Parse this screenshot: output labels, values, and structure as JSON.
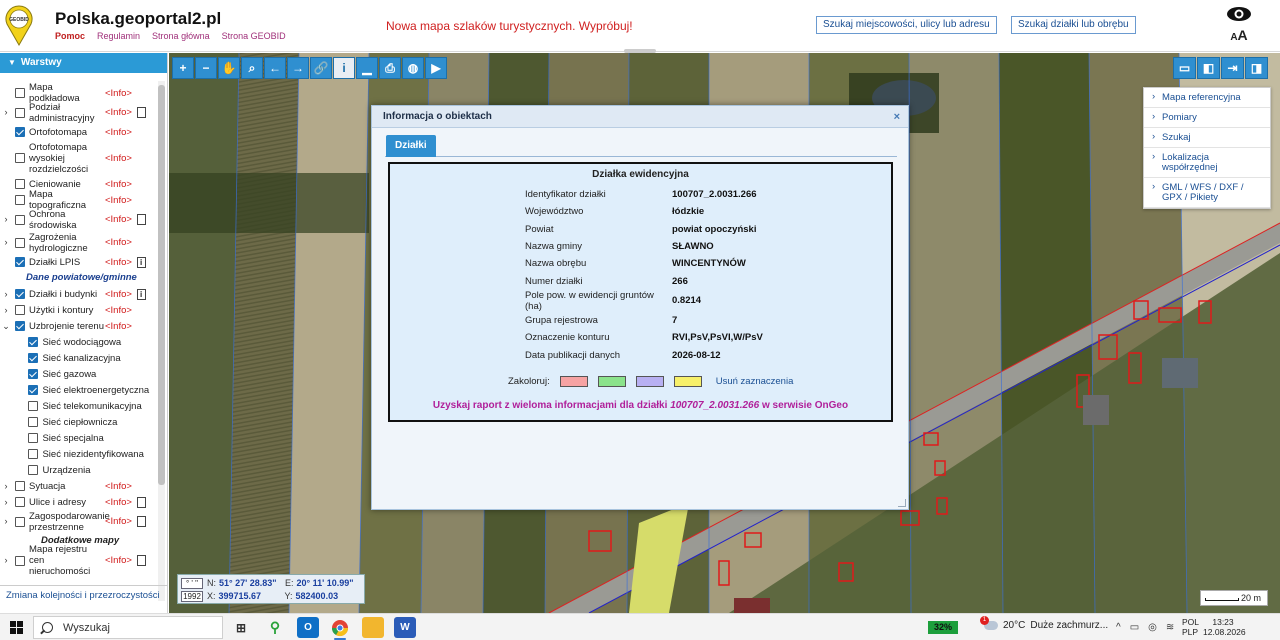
{
  "header": {
    "title": "Polska.geoportal2.pl",
    "links": [
      "Pomoc",
      "Regulamin",
      "Strona główna",
      "Strona GEOBID"
    ],
    "promo": "Nowa mapa szlaków turystycznych. Wypróbuj!",
    "search_address_button": "Szukaj miejscowości, ulicy lub adresu",
    "search_parcel_button": "Szukaj działki lub obrębu",
    "font_size_label": "AA",
    "logo_text": "GEOBID"
  },
  "sidebar": {
    "header": "Warstwy",
    "info_label": "<Info>",
    "layers": [
      {
        "name": "Mapa podkładowa",
        "checked": false,
        "expand": false,
        "doc": false,
        "lines": 1
      },
      {
        "name": "Podział administracyjny",
        "checked": false,
        "expand": true,
        "doc": true,
        "lines": 2
      },
      {
        "name": "Ortofotomapa",
        "checked": true,
        "expand": false,
        "doc": false,
        "lines": 1
      },
      {
        "name": "Ortofotomapa wysokiej rozdzielczości",
        "checked": false,
        "expand": false,
        "doc": false,
        "lines": 3
      },
      {
        "name": "Cieniowanie",
        "checked": false,
        "expand": false,
        "doc": false,
        "lines": 1
      },
      {
        "name": "Mapa topograficzna",
        "checked": false,
        "expand": false,
        "doc": false,
        "lines": 1
      },
      {
        "name": "Ochrona środowiska",
        "checked": false,
        "expand": true,
        "doc": true,
        "lines": 2
      },
      {
        "name": "Zagrożenia hydrologiczne",
        "checked": false,
        "expand": true,
        "doc": false,
        "lines": 2
      },
      {
        "name": "Działki LPIS",
        "checked": true,
        "expand": false,
        "doc": "i",
        "lines": 1
      }
    ],
    "section_county": "Dane powiatowe/gminne",
    "county_layers": [
      {
        "name": "Działki i budynki",
        "checked": true,
        "expand": true,
        "doc": "i"
      },
      {
        "name": "Użytki i kontury",
        "checked": false,
        "expand": true,
        "doc": false
      },
      {
        "name": "Uzbrojenie terenu",
        "checked": true,
        "expand": "open",
        "doc": false
      }
    ],
    "utility_sublayers": [
      {
        "name": "Sieć wodociągowa",
        "checked": true
      },
      {
        "name": "Sieć kanalizacyjna",
        "checked": true
      },
      {
        "name": "Sieć gazowa",
        "checked": true
      },
      {
        "name": "Sieć elektroenergetyczna",
        "checked": true
      },
      {
        "name": "Sieć telekomunikacyjna",
        "checked": false
      },
      {
        "name": "Sieć ciepłownicza",
        "checked": false
      },
      {
        "name": "Sieć specjalna",
        "checked": false
      },
      {
        "name": "Sieć niezidentyfikowana",
        "checked": false
      },
      {
        "name": "Urządzenia",
        "checked": false
      }
    ],
    "more_layers": [
      {
        "name": "Sytuacja",
        "checked": false,
        "expand": true,
        "doc": false,
        "lines": 1
      },
      {
        "name": "Ulice i adresy",
        "checked": false,
        "expand": true,
        "doc": true,
        "lines": 1
      },
      {
        "name": "Zagospodarowanie przestrzenne",
        "checked": false,
        "expand": true,
        "doc": true,
        "lines": 2
      }
    ],
    "section_additional": "Dodatkowe mapy",
    "additional_layers": [
      {
        "name": "Mapa rejestru cen nieruchomości",
        "checked": false,
        "expand": true,
        "doc": true,
        "lines": 2
      }
    ],
    "footer_link": "Zmiana kolejności i przezroczystości"
  },
  "toolbar": {
    "icons": [
      "zoom-in-icon",
      "zoom-out-icon",
      "pan-hand-icon",
      "zoom-box-icon",
      "back-arrow-icon",
      "forward-arrow-icon",
      "link-icon",
      "info-icon",
      "measure-icon",
      "print-icon",
      "globe-icon",
      "video-icon"
    ],
    "glyphs": [
      "+",
      "−",
      "✋",
      "⌕",
      "←",
      "→",
      "🔗",
      "i",
      "▁",
      "⎙",
      "◍",
      "▶"
    ],
    "active": "info-icon"
  },
  "right_tools": {
    "icons": [
      "layout-top-icon",
      "layout-left-icon",
      "export-icon",
      "layout-right-icon"
    ],
    "glyphs": [
      "▭",
      "◧",
      "⇥",
      "◨"
    ]
  },
  "right_menu": [
    "Mapa referencyjna",
    "Pomiary",
    "Szukaj",
    "Lokalizacja współrzędnej",
    "GML / WFS / DXF / GPX / Pikiety"
  ],
  "dialog": {
    "title": "Informacja o obiektach",
    "close": "×",
    "tab": "Działki",
    "heading": "Działka ewidencyjna",
    "attributes": [
      {
        "key": "Identyfikator działki",
        "value": "100707_2.0031.266"
      },
      {
        "key": "Województwo",
        "value": "łódzkie"
      },
      {
        "key": "Powiat",
        "value": "powiat opoczyński"
      },
      {
        "key": "Nazwa gminy",
        "value": "SŁAWNO"
      },
      {
        "key": "Nazwa obrębu",
        "value": "WINCENTYNÓW"
      },
      {
        "key": "Numer działki",
        "value": "266"
      },
      {
        "key": "Pole pow. w ewidencji gruntów (ha)",
        "value": "0.8214"
      },
      {
        "key": "Grupa rejestrowa",
        "value": "7"
      },
      {
        "key": "Oznaczenie konturu",
        "value": "RVI,PsV,PsVI,W/PsV"
      },
      {
        "key": "Data publikacji danych",
        "value": "2026-08-12"
      }
    ],
    "color_label": "Zakoloruj:",
    "colors": [
      "#f6a3a3",
      "#8be38b",
      "#b8b0f2",
      "#f7f06a"
    ],
    "clear_label": "Usuń zaznaczenia",
    "report_prefix": "Uzyskaj raport z wieloma informacjami dla działki",
    "report_parcel": "100707_2.0031.266",
    "report_suffix": "w serwisie OnGeo"
  },
  "coords": {
    "tag1": "° ' \"",
    "tag2": "1992",
    "n_label": "N:",
    "n_value": "51° 27' 28.83\"",
    "e_label": "E:",
    "e_value": "20° 11' 10.99\"",
    "x_label": "X:",
    "x_value": "399715.67",
    "y_label": "Y:",
    "y_value": "582400.03"
  },
  "scale": {
    "label": "20 m"
  },
  "taskbar": {
    "search_placeholder": "Wyszukaj",
    "battery": "32%",
    "temperature": "20°C",
    "weather": "Duże zachmurz...",
    "weather_badge": "1",
    "lang1": "POL",
    "lang2": "PLP",
    "time": "13:23",
    "date": "12.08.2026"
  },
  "colors": {
    "accent": "#2f8fd0",
    "info_red": "#d01818",
    "link_blue": "#1a4f93",
    "report_magenta": "#b0209a"
  }
}
